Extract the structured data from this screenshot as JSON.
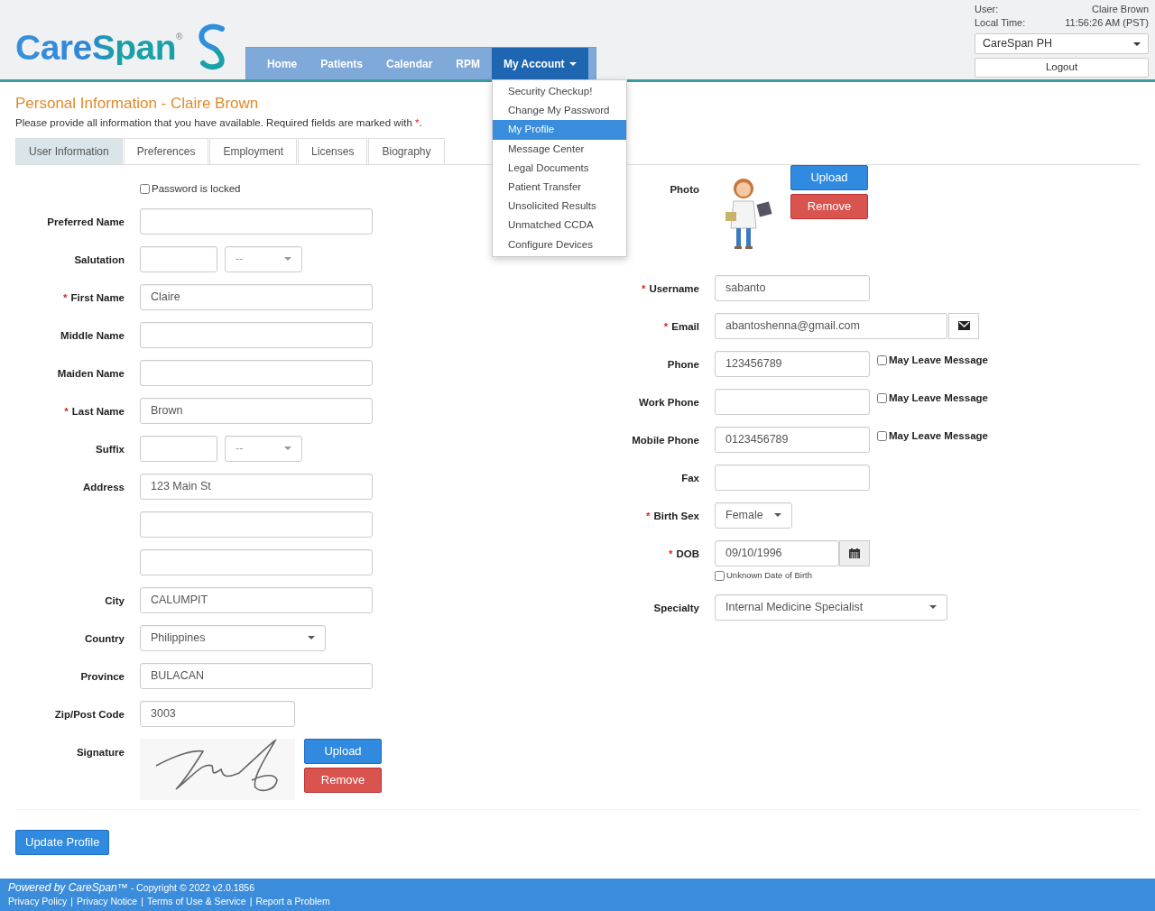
{
  "header": {
    "logo": "CareSpan",
    "logo_mark": "®",
    "nav": [
      {
        "label": "Home",
        "selected": false
      },
      {
        "label": "Patients",
        "selected": false
      },
      {
        "label": "Calendar",
        "selected": false
      },
      {
        "label": "RPM",
        "selected": false
      },
      {
        "label": "My Account",
        "selected": true,
        "has_menu": true
      }
    ],
    "menu": [
      {
        "label": "Security Checkup!",
        "selected": false
      },
      {
        "label": "Change My Password",
        "selected": false
      },
      {
        "label": "My Profile",
        "selected": true
      },
      {
        "label": "Message Center",
        "selected": false
      },
      {
        "label": "Legal Documents",
        "selected": false
      },
      {
        "label": "Patient Transfer",
        "selected": false
      },
      {
        "label": "Unsolicited Results",
        "selected": false
      },
      {
        "label": "Unmatched CCDA",
        "selected": false
      },
      {
        "label": "Configure Devices",
        "selected": false
      }
    ],
    "user": {
      "user_label": "User:",
      "user_value": "Claire Brown",
      "time_label": "Local Time:",
      "time_value": "11:56:26 AM (PST)",
      "practice": "CareSpan PH",
      "logout": "Logout"
    }
  },
  "required_mark": "*",
  "title": "Personal Information - Claire Brown",
  "instruction": {
    "text": "Please provide all information that you have available. Required fields are marked with",
    "end": "."
  },
  "tabs": [
    {
      "label": "User Information",
      "selected": true
    },
    {
      "label": "Preferences",
      "selected": false
    },
    {
      "label": "Employment",
      "selected": false
    },
    {
      "label": "Licenses",
      "selected": false
    },
    {
      "label": "Biography",
      "selected": false
    }
  ],
  "left_fields": [
    {
      "kind": "checkbox",
      "label": "Password is locked",
      "checked": false
    },
    {
      "kind": "text",
      "label": "Preferred Name",
      "required": false
    },
    {
      "kind": "text_select",
      "label": "Salutation",
      "required": false,
      "select_value": "--"
    },
    {
      "kind": "text",
      "label": "First Name",
      "required": true,
      "value": "Claire"
    },
    {
      "kind": "text",
      "label": "Middle Name",
      "required": false
    },
    {
      "kind": "text",
      "label": "Maiden Name",
      "required": false
    },
    {
      "kind": "text",
      "label": "Last Name",
      "required": true,
      "value": "Brown"
    },
    {
      "kind": "text_select",
      "label": "Suffix",
      "required": false,
      "select_value": "--"
    },
    {
      "kind": "text",
      "label": "Address",
      "required": false,
      "value": "123 Main St"
    },
    {
      "kind": "text",
      "required": false
    },
    {
      "kind": "text",
      "required": false
    },
    {
      "kind": "text",
      "label": "City",
      "required": false,
      "value": "CALUMPIT"
    },
    {
      "kind": "select",
      "label": "Country",
      "required": false,
      "value": "Philippines"
    },
    {
      "kind": "text",
      "label": "Province",
      "required": false,
      "value": "BULACAN"
    },
    {
      "kind": "short_text",
      "label": "Zip/Post Code",
      "required": false,
      "value": "3003"
    },
    {
      "kind": "signature",
      "label": "Signature",
      "required": false,
      "buttons": [
        "Upload",
        "Remove"
      ]
    }
  ],
  "right_fields": [
    {
      "kind": "photo",
      "label": "Photo",
      "required": false,
      "buttons": [
        "Upload",
        "Remove"
      ]
    },
    {
      "kind": "text",
      "label": "Username",
      "required": true,
      "value": "sabanto"
    },
    {
      "kind": "email",
      "label": "Email",
      "required": true,
      "value": "abantoshenna@gmail.com"
    },
    {
      "kind": "phone",
      "label": "Phone",
      "required": false,
      "value": "123456789",
      "check_label": "May Leave Message",
      "checked": false
    },
    {
      "kind": "phone",
      "label": "Work Phone",
      "required": false,
      "check_label": "May Leave Message",
      "checked": false
    },
    {
      "kind": "phone",
      "label": "Mobile Phone",
      "required": false,
      "value": "0123456789",
      "check_label": "May Leave Message",
      "checked": false
    },
    {
      "kind": "text",
      "label": "Fax",
      "required": false
    },
    {
      "kind": "small_select",
      "label": "Birth Sex",
      "required": true,
      "value": "Female"
    },
    {
      "kind": "date",
      "label": "DOB",
      "required": true,
      "value": "09/10/1996",
      "check_label": "Unknown Date of Birth",
      "checked": false
    },
    {
      "kind": "select",
      "label": "Specialty",
      "required": false,
      "value": "Internal Medicine Specialist"
    }
  ],
  "submit": "Update Profile",
  "footer": {
    "powered": "Powered by CareSpan™",
    "copyright": "- Copyright © 2022 v2.0.1856",
    "separator": "|",
    "links": [
      "Privacy Policy",
      "Privacy Notice",
      "Terms of Use & Service",
      "Report a Problem"
    ]
  }
}
